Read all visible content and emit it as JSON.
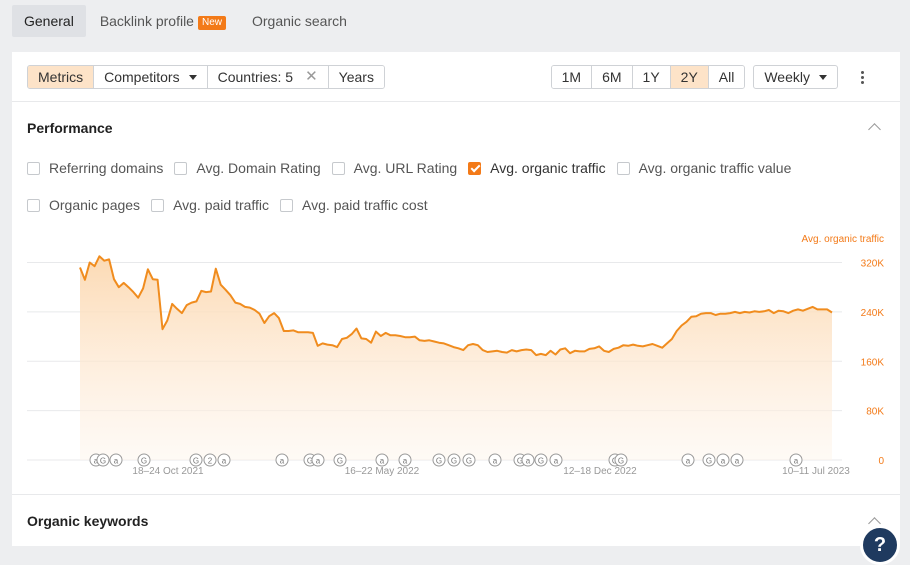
{
  "tabs": [
    {
      "label": "General",
      "active": true
    },
    {
      "label": "Backlink profile",
      "badge": "New"
    },
    {
      "label": "Organic search"
    }
  ],
  "toolbar": {
    "metrics": "Metrics",
    "competitors": "Competitors",
    "countries": "Countries: 5",
    "years": "Years",
    "ranges": [
      "1M",
      "6M",
      "1Y",
      "2Y",
      "All"
    ],
    "active_range": "2Y",
    "interval": "Weekly"
  },
  "performance": {
    "title": "Performance",
    "checkboxes_row1": [
      {
        "label": "Referring domains",
        "checked": false
      },
      {
        "label": "Avg. Domain Rating",
        "checked": false
      },
      {
        "label": "Avg. URL Rating",
        "checked": false
      },
      {
        "label": "Avg. organic traffic",
        "checked": true
      },
      {
        "label": "Avg. organic traffic value",
        "checked": false
      }
    ],
    "checkboxes_row2": [
      {
        "label": "Organic pages",
        "checked": false
      },
      {
        "label": "Avg. paid traffic",
        "checked": false
      },
      {
        "label": "Avg. paid traffic cost",
        "checked": false
      }
    ]
  },
  "organic_keywords": {
    "title": "Organic keywords"
  },
  "help_label": "?",
  "colors": {
    "accent": "#f37a18",
    "line": "#f08c1e",
    "fill": "#fde3c8"
  },
  "chart_data": {
    "type": "area",
    "series": [
      {
        "name": "Avg. organic traffic",
        "values": [
          312,
          292,
          320,
          314,
          330,
          323,
          325,
          293,
          280,
          287,
          280,
          272,
          263,
          278,
          309,
          293,
          292,
          212,
          226,
          253,
          245,
          238,
          251,
          255,
          257,
          274,
          272,
          273,
          310,
          284,
          276,
          267,
          255,
          253,
          248,
          247,
          243,
          237,
          222,
          233,
          238,
          230,
          209,
          209,
          210,
          207,
          207,
          207,
          206,
          185,
          189,
          187,
          186,
          183,
          196,
          198,
          204,
          213,
          197,
          196,
          190,
          208,
          201,
          206,
          202,
          202,
          201,
          199,
          199,
          200,
          194,
          193,
          194,
          192,
          190,
          189,
          186,
          183,
          181,
          178,
          186,
          188,
          186,
          178,
          175,
          176,
          177,
          175,
          174,
          178,
          176,
          178,
          179,
          178,
          170,
          172,
          170,
          177,
          171,
          179,
          181,
          173,
          177,
          176,
          176,
          180,
          181,
          184,
          177,
          175,
          180,
          182,
          186,
          185,
          187,
          185,
          184,
          186,
          188,
          185,
          182,
          189,
          196,
          209,
          218,
          224,
          232,
          233,
          237,
          238,
          238,
          235,
          237,
          237,
          238,
          240,
          238,
          240,
          239,
          241,
          240,
          241,
          243,
          238,
          242,
          241,
          238,
          242,
          244,
          242,
          245,
          248,
          244,
          244,
          244,
          239
        ]
      }
    ],
    "ylim": [
      0,
      350
    ],
    "yticks": [
      "320K",
      "240K",
      "160K",
      "80K",
      "0"
    ],
    "ytick_values": [
      320,
      240,
      160,
      80,
      0
    ],
    "xticks": [
      "18–24 Oct 2021",
      "16–22 May 2022",
      "12–18 Dec 2022",
      "10–11 Jul 2023"
    ],
    "legend": "Avg. organic traffic",
    "grid": true,
    "annotations": [
      "(a)",
      "G",
      "(a)",
      "G",
      "G",
      "2",
      "(a)",
      "(a)",
      "G",
      "(a)",
      "G",
      "(a)",
      "(a)",
      "G",
      "G",
      "G",
      "(a)",
      "G",
      "(a)",
      "G",
      "(a)",
      "G",
      "G",
      "(a)",
      "G",
      "(a)",
      "(a)"
    ]
  }
}
